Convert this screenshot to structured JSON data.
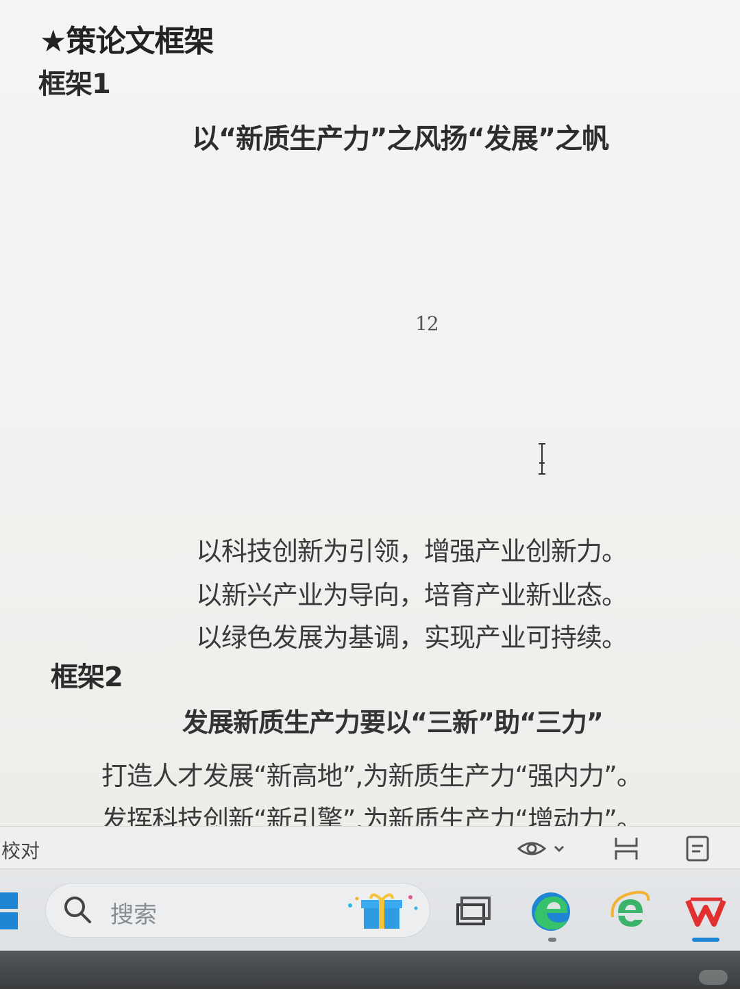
{
  "document": {
    "heading": "★策论文框架",
    "frame1": {
      "label": "框架1",
      "title": "以“新质生产力”之风扬“发展”之帆",
      "lines": [
        "以科技创新为引领，增强产业创新力。",
        "以新兴产业为导向，培育产业新业态。",
        "以绿色发展为基调，实现产业可持续。"
      ]
    },
    "page_number": "12",
    "frame2": {
      "label": "框架2",
      "title": "发展新质生产力要以“三新”助“三力”",
      "lines": [
        "打造人才发展“新高地”,为新质生产力“强内力”。",
        "发挥科技创新“新引擎”,为新质生产力“增动力”。"
      ]
    }
  },
  "status_bar": {
    "proofread_label": "校对",
    "icons": [
      "eye-icon",
      "chevron-down-icon",
      "page-width-icon",
      "document-view-icon"
    ]
  },
  "taskbar": {
    "search_placeholder": "搜索",
    "icons": [
      "windows-start-icon",
      "search-icon",
      "gift-icon",
      "task-view-icon",
      "edge-icon",
      "ie-icon",
      "wps-icon"
    ],
    "colors": {
      "accent": "#1f86d6",
      "edge_green": "#35c26b",
      "wps_red": "#e0302f"
    }
  }
}
